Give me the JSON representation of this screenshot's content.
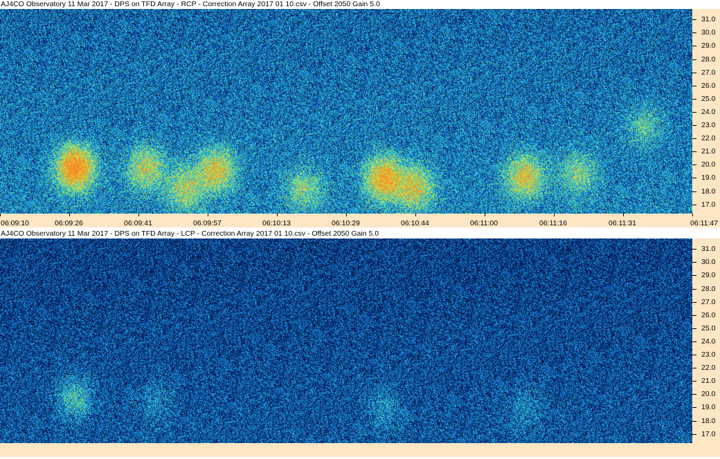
{
  "chart_data": [
    {
      "type": "heatmap",
      "title": "AJ4CO Observatory 11 Mar 2017  -  DPS on TFD Array  -  RCP  -  Correction Array 2017 01 10.csv  -  Offset 2050  Gain 5.0",
      "x_tick_labels": [
        "06:09:10",
        "06:09:26",
        "06:09:41",
        "06:09:57",
        "06:10:13",
        "06:10:29",
        "06:10:44",
        "06:11:00",
        "06:11:16",
        "06:11:31",
        "06:11:47"
      ],
      "y_tick_labels": [
        "31.0",
        "30.0",
        "29.0",
        "28.0",
        "27.0",
        "26.0",
        "25.0",
        "24.0",
        "23.0",
        "22.0",
        "21.0",
        "20.0",
        "19.0",
        "18.0",
        "17.0"
      ],
      "ylim": [
        16.3,
        31.8
      ],
      "xlim": [
        "06:09:10",
        "06:11:47"
      ],
      "colormap": [
        "#05164a",
        "#0c3c8c",
        "#1470c8",
        "#22a8e0",
        "#40d6c8",
        "#9aea5a",
        "#e8d83a",
        "#f0902a"
      ],
      "emission_regions": [
        {
          "t": "06:09:27",
          "f": 19.8,
          "intensity": 0.95
        },
        {
          "t": "06:09:43",
          "f": 19.8,
          "intensity": 0.5
        },
        {
          "t": "06:09:52",
          "f": 18.2,
          "intensity": 0.45
        },
        {
          "t": "06:09:59",
          "f": 19.6,
          "intensity": 0.6
        },
        {
          "t": "06:10:19",
          "f": 18.2,
          "intensity": 0.35
        },
        {
          "t": "06:10:37",
          "f": 19.0,
          "intensity": 0.75
        },
        {
          "t": "06:10:44",
          "f": 18.3,
          "intensity": 0.55
        },
        {
          "t": "06:11:09",
          "f": 19.1,
          "intensity": 0.6
        },
        {
          "t": "06:11:21",
          "f": 19.3,
          "intensity": 0.35
        },
        {
          "t": "06:11:36",
          "f": 23.0,
          "intensity": 0.25
        }
      ]
    },
    {
      "type": "heatmap",
      "title": "AJ4CO Observatory 11 Mar 2017  -  DPS on TFD Array  -  LCP  -  Correction Array 2017 01 10.csv  -  Offset 2050  Gain 5.0",
      "x_tick_labels": [],
      "y_tick_labels": [
        "31.0",
        "30.0",
        "29.0",
        "28.0",
        "27.0",
        "26.0",
        "25.0",
        "24.0",
        "23.0",
        "22.0",
        "21.0",
        "20.0",
        "19.0",
        "18.0",
        "17.0"
      ],
      "ylim": [
        16.3,
        31.8
      ],
      "xlim": [
        "06:09:10",
        "06:11:47"
      ],
      "colormap": [
        "#05164a",
        "#0c3c8c",
        "#1470c8",
        "#22a8e0",
        "#40d6c8",
        "#9aea5a",
        "#e8d83a",
        "#f0902a"
      ],
      "emission_regions": [
        {
          "t": "06:09:27",
          "f": 19.8,
          "intensity": 0.35
        },
        {
          "t": "06:09:45",
          "f": 19.5,
          "intensity": 0.15
        },
        {
          "t": "06:10:37",
          "f": 19.0,
          "intensity": 0.18
        },
        {
          "t": "06:11:09",
          "f": 19.0,
          "intensity": 0.15
        }
      ]
    }
  ]
}
